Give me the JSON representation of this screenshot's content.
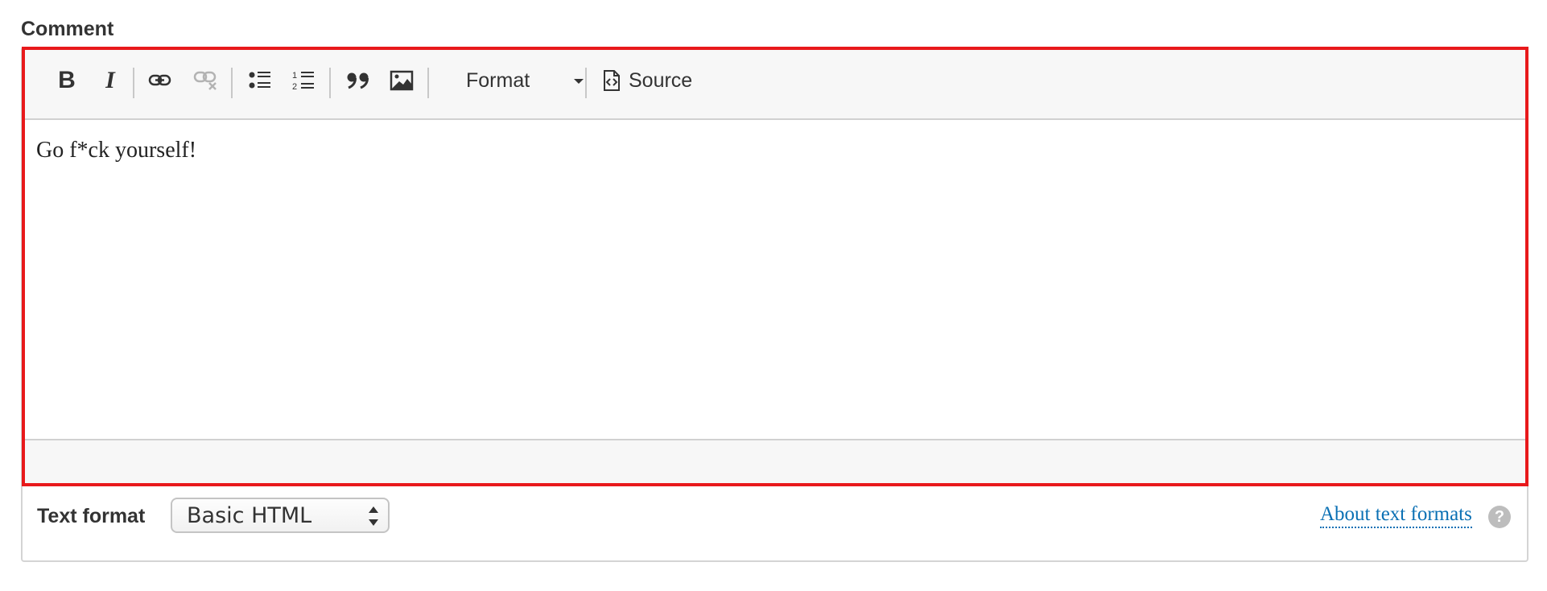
{
  "field": {
    "label": "Comment"
  },
  "toolbar": {
    "bold_label": "B",
    "italic_label": "I",
    "format_label": "Format",
    "source_label": "Source",
    "icons": [
      "bold-icon",
      "italic-icon",
      "link-icon",
      "unlink-icon",
      "bulleted-list-icon",
      "numbered-list-icon",
      "blockquote-icon",
      "image-icon",
      "source-icon"
    ]
  },
  "editor": {
    "content": "Go f*ck yourself!",
    "highlight_color": "#e8191b"
  },
  "text_format": {
    "label": "Text format",
    "selected": "Basic HTML",
    "about_link": "About text formats",
    "help_glyph": "?"
  }
}
